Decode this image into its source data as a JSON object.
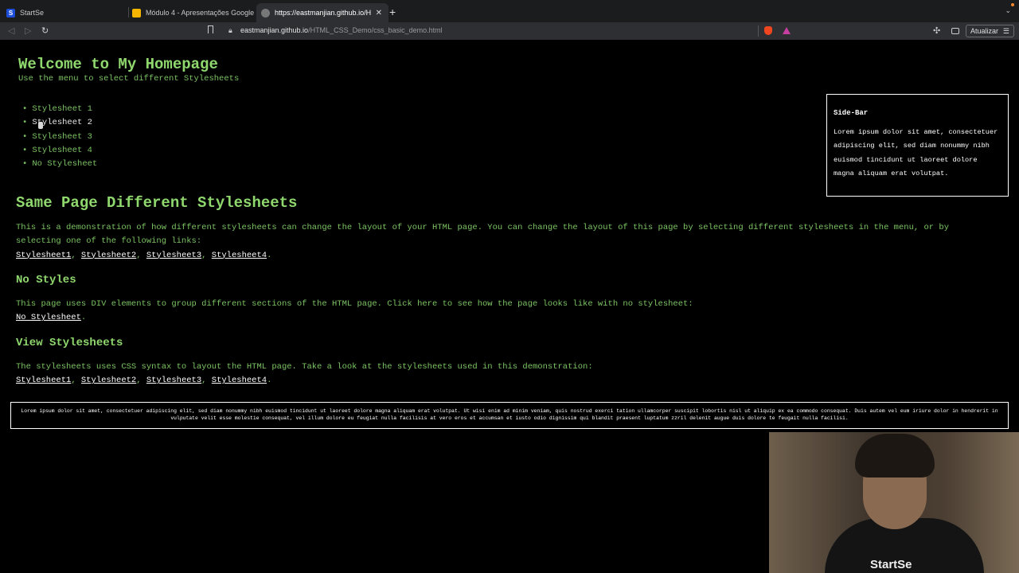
{
  "browser": {
    "tabs": [
      {
        "label": "StartSe",
        "favicon": "S",
        "favicon_color": "#1d4ed8"
      },
      {
        "label": "Módulo 4 - Apresentações Google",
        "favicon": "",
        "favicon_color": "#f4b400"
      },
      {
        "label": "https://eastmanjian.github.io/H",
        "favicon": "",
        "favicon_color": "#8a8a8a"
      }
    ],
    "url_host": "eastmanjian.github.io",
    "url_path": "/HTML_CSS_Demo/css_basic_demo.html",
    "update_label": "Atualizar"
  },
  "page": {
    "title": "Welcome to My Homepage",
    "subtitle": "Use the menu to select different Stylesheets",
    "menu": [
      "Stylesheet 1",
      "Stylesheet 2",
      "Stylesheet 3",
      "Stylesheet 4",
      "No Stylesheet"
    ],
    "sidebar": {
      "title": "Side-Bar",
      "text": "Lorem ipsum dolor sit amet, consectetuer adipiscing elit, sed diam nonummy nibh euismod tincidunt ut laoreet dolore magna aliquam erat volutpat."
    },
    "section1": {
      "heading": "Same Page Different Stylesheets",
      "text": "This is a demonstration of how different stylesheets can change the layout of your HTML page. You can change the layout of this page by selecting different stylesheets in the menu, or by selecting one of the following links:",
      "links": [
        "Stylesheet1",
        "Stylesheet2",
        "Stylesheet3",
        "Stylesheet4"
      ]
    },
    "section2": {
      "heading": "No Styles",
      "text": "This page uses DIV elements to group different sections of the HTML page. Click here to see how the page looks like with no stylesheet:",
      "link": "No Stylesheet"
    },
    "section3": {
      "heading": "View Stylesheets",
      "text": "The stylesheets uses CSS syntax to layout the HTML page. Take a look at the stylesheets used in this demonstration:",
      "links": [
        "Stylesheet1",
        "Stylesheet2",
        "Stylesheet3",
        "Stylesheet4"
      ]
    },
    "footer": "Lorem ipsum dolor sit amet, consectetuer adipiscing elit, sed diam nonummy nibh euismod tincidunt ut laoreet dolore magna aliquam erat volutpat. Ut wisi enim ad minim veniam, quis nostrud exerci tation ullamcorper suscipit lobortis nisl ut aliquip ex ea commodo consequat. Duis autem vel eum iriure dolor in hendrerit in vulputate velit esse molestie consequat, vel illum dolore eu feugiat nulla facilisis at vero eros et accumsan et iusto odio dignissim qui blandit praesent luptatum zzril delenit augue duis dolore te feugait nulla facilisi."
  },
  "webcam": {
    "shirt_logo": "StartSe"
  }
}
